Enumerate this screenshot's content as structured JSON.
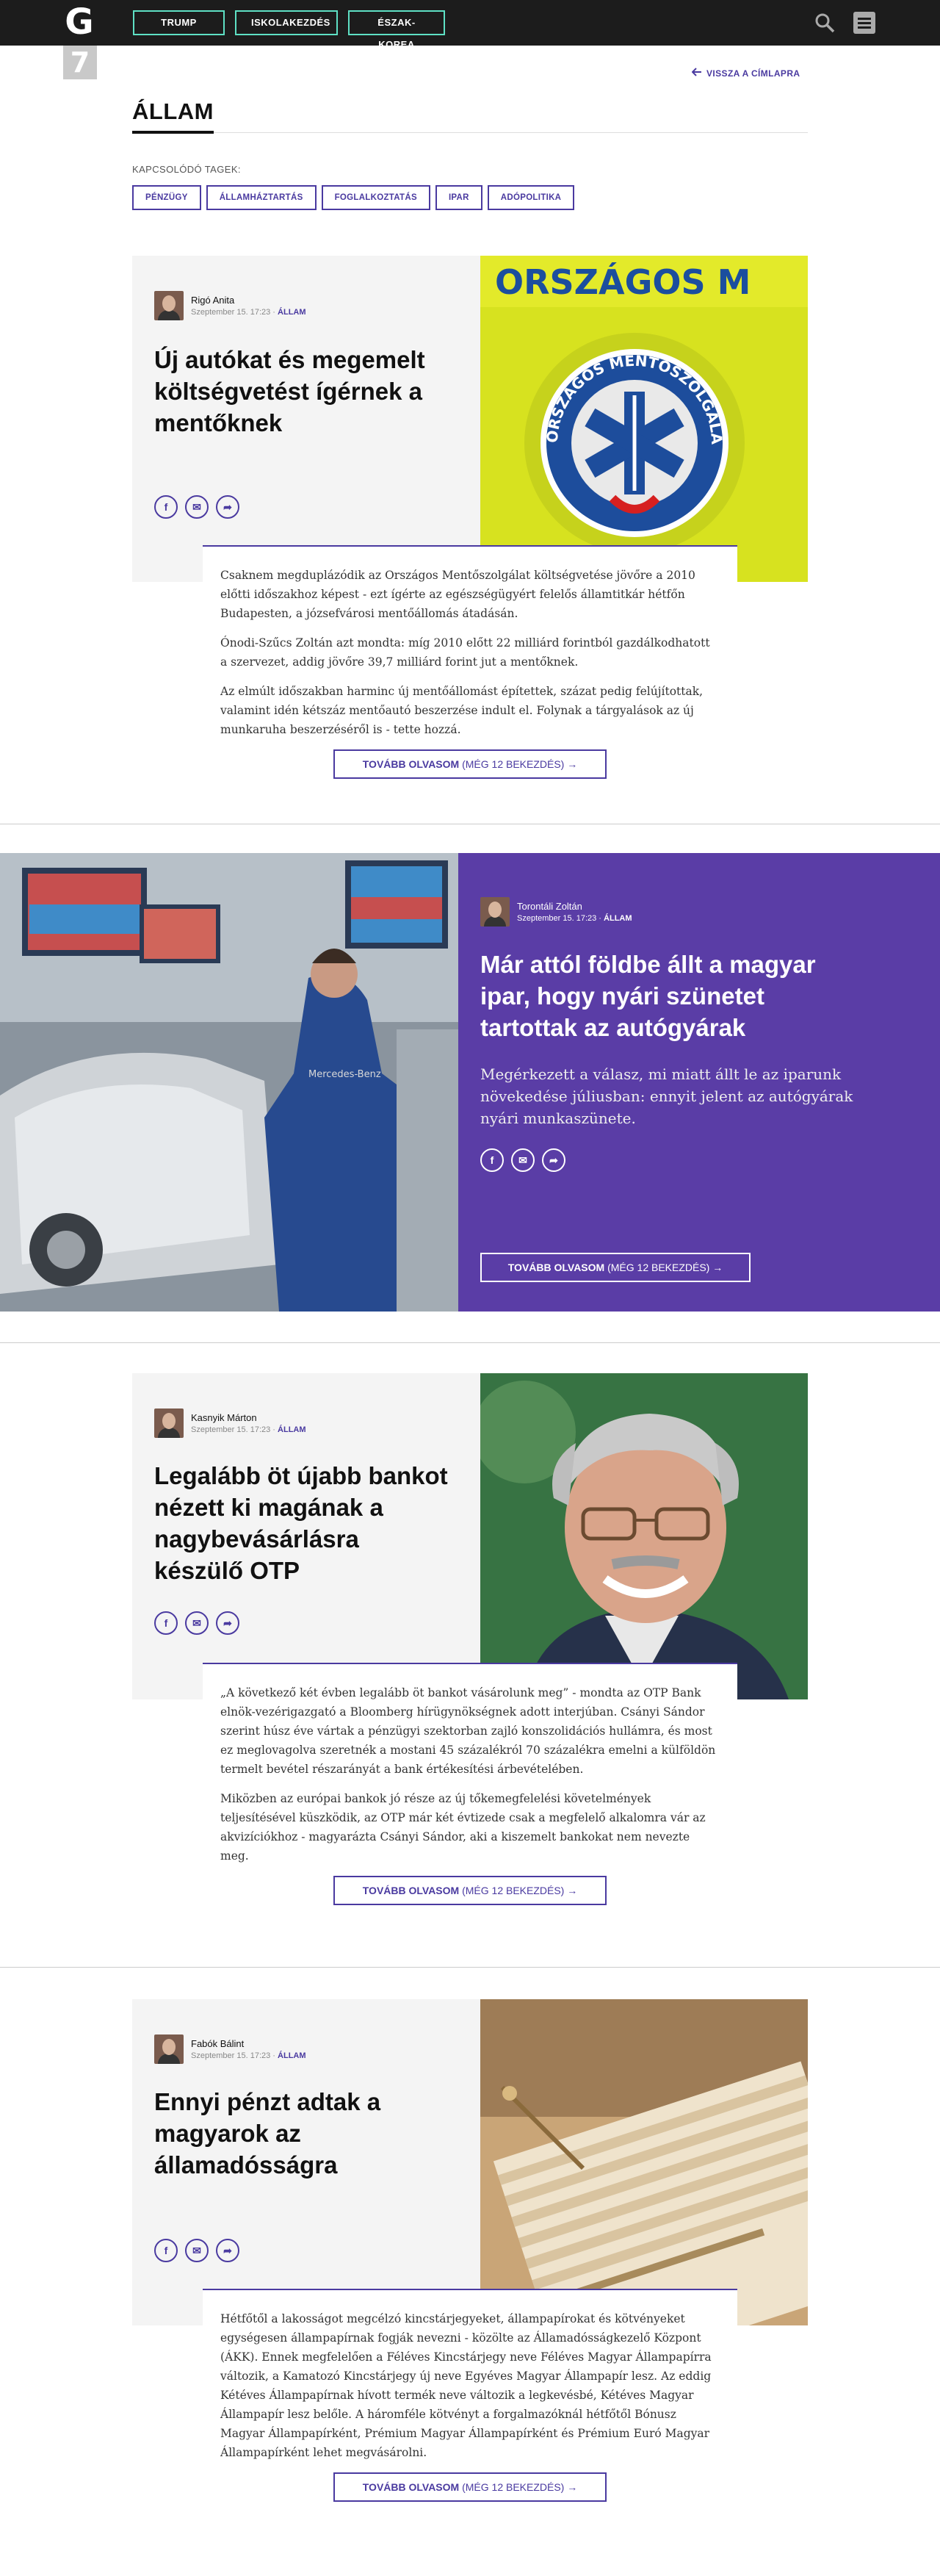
{
  "header": {
    "logo": "G",
    "nav_tags": [
      "TRUMP",
      "ISKOLAKEZDÉS",
      "ÉSZAK-KOREA"
    ],
    "day_badge": "7"
  },
  "back_link": "VISSZA A CÍMLAPRA",
  "section": {
    "title": "ÁLLAM",
    "related_label": "KAPCSOLÓDÓ TAGEK:",
    "tags": [
      "PÉNZÜGY",
      "ÁLLAMHÁZTARTÁS",
      "FOGLALKOZTATÁS",
      "IPAR",
      "ADÓPOLITIKA"
    ]
  },
  "articles": [
    {
      "author": "Rigó Anita",
      "date": "Szeptember 15. 17:23",
      "category": "ÁLLAM",
      "headline": "Új autókat és megemelt költségvetést ígérnek a mentőknek",
      "paragraphs": [
        "Csaknem megduplázódik az Országos Mentőszolgálat költségvetése jövőre a 2010 előtti időszakhoz képest - ezt ígérte az egészségügyért felelős államtitkár hétfőn Budapesten, a józsefvárosi mentőállomás átadásán.",
        "Ónodi-Szűcs Zoltán azt mondta: míg 2010 előtt 22 milliárd forintból gazdálkodhatott a szervezet, addig jövőre 39,7 milliárd forint jut a mentőknek.",
        "Az elmúlt időszakban harminc új mentőállomást építettek, százat pedig felújítottak, valamint idén kétszáz mentőautó beszerzése indult el. Folynak a tárgyalások az új munkaruha beszerzéséről is - tette hozzá."
      ],
      "image_text_top": "ORSZÁGOS M",
      "image_text_ring": "ORSZÁGOS MENTŐSZOLGÁLAT"
    },
    {
      "author": "Torontáli Zoltán",
      "date": "Szeptember 15. 17:23",
      "category": "ÁLLAM",
      "headline": "Már attól földbe állt a magyar ipar, hogy nyári szünetet tartottak az autógyárak",
      "lead": "Megérkezett a válasz, mi miatt állt le az iparunk növekedése júliusban: ennyit jelent az autógyárak nyári munkaszünete.",
      "image_text": "Mercedes-Benz"
    },
    {
      "author": "Kasnyik Márton",
      "date": "Szeptember 15. 17:23",
      "category": "ÁLLAM",
      "headline": "Legalább öt újabb bankot nézett ki magának a nagybevásárlásra készülő OTP",
      "paragraphs": [
        "„A következő két évben legalább öt bankot vásárolunk meg” - mondta az OTP Bank elnök-vezérigazgató a Bloomberg hírügynökségnek adott interjúban. Csányi Sándor szerint húsz éve vártak a pénzügyi szektorban zajló konszolidációs hullámra, és most ez meglovagolva szeretnék a mostani 45 százalékról 70 százalékra emelni a külföldön termelt bevétel részarányát a bank értékesítési árbevételében.",
        "Miközben az európai bankok jó része az új tőkemegfelelési követelmények teljesítésével küszködik, az OTP már két évtizede csak a megfelelő alkalomra vár az akvizíciókhoz - magyarázta Csányi Sándor, aki a kiszemelt bankokat nem nevezte meg."
      ]
    },
    {
      "author": "Fabók Bálint",
      "date": "Szeptember 15. 17:23",
      "category": "ÁLLAM",
      "headline": "Ennyi pénzt adtak a magyarok az államadósságra",
      "paragraphs": [
        "Hétfőtől a lakosságot megcélzó kincstárjegyeket, állampapírokat és kötvényeket egységesen állampapírnak fogják nevezni - közölte az Államadósságkezelő Központ (ÁKK). Ennek megfelelően a Féléves Kincstárjegy neve Féléves Magyar Állampapírra változik, a Kamatozó Kincstárjegy új neve Egyéves Magyar Állampapír lesz. Az eddig Kétéves Állampapírnak hívott termék neve változik a legkevésbé, Kétéves Magyar Állampapír lesz belőle. A háromféle kötvényt a forgalmazóknál hétfőtől Bónusz Magyar Állampapírként, Prémium Magyar Állampapírként és Prémium Euró Magyar Állampapírként lehet megvásárolni."
      ]
    }
  ],
  "more_button": {
    "bold": "TOVÁBB OLVASOM",
    "rest": " (MÉG 12 BEKEZDÉS)"
  },
  "colors": {
    "accent": "#4a3aa0",
    "feature_bg": "#5a3da6",
    "nav_border": "#5ee0c4",
    "topbar": "#1c1c1c"
  },
  "icons": [
    "search-icon",
    "menu-icon",
    "arrow-left-icon",
    "arrow-right-icon",
    "facebook-icon",
    "email-icon",
    "share-icon"
  ]
}
